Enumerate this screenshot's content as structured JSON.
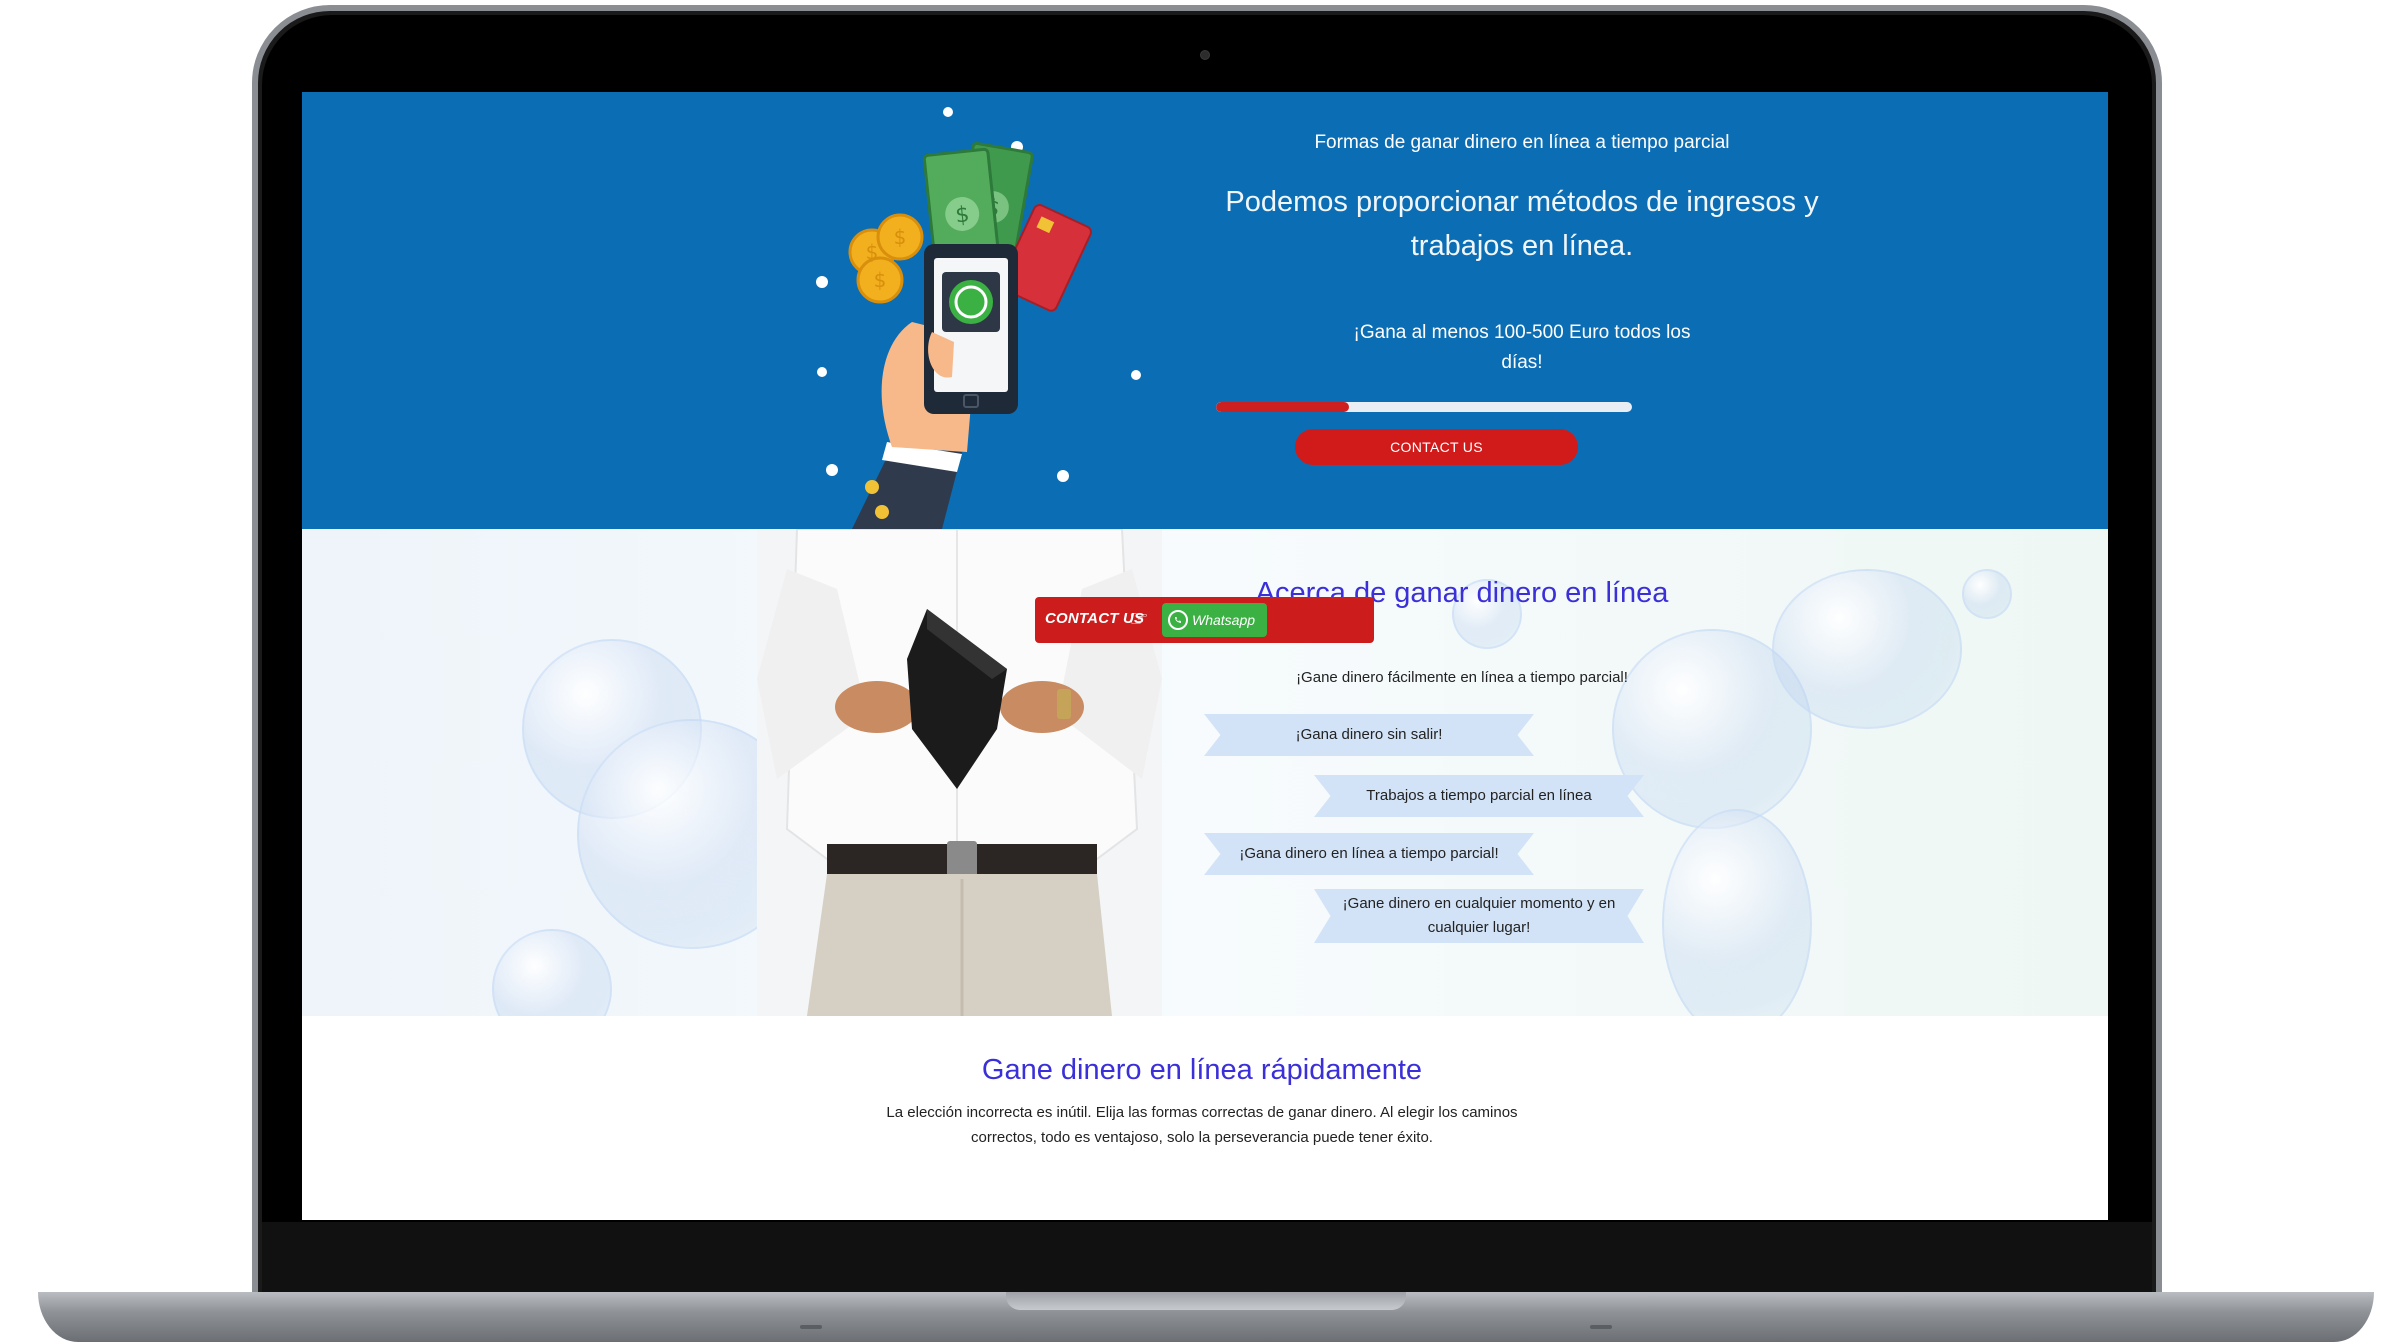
{
  "hero": {
    "subtitle": "Formas de ganar dinero en línea a tiempo parcial",
    "title": "Podemos proporcionar métodos de ingresos y trabajos en línea.",
    "earn_text": "¡Gana al menos 100-500 Euro todos los días!",
    "progress_fraction": 0.32,
    "button_label": "CONTACT US"
  },
  "floating_bar": {
    "contact_label": "CONTACT US",
    "whatsapp_label": "Whatsapp"
  },
  "about": {
    "title": "Acerca de ganar dinero en línea",
    "lead": "¡Gane dinero fácilmente en línea a tiempo parcial!",
    "items": [
      "¡Gana dinero sin salir!",
      "Trabajos a tiempo parcial en línea",
      "¡Gana dinero en línea a tiempo parcial!",
      "¡Gane dinero en cualquier momento y en cualquier lugar!"
    ]
  },
  "bottom": {
    "title": "Gane dinero en línea rápidamente",
    "text": "La elección incorrecta es inútil. Elija las formas correctas de ganar dinero. Al elegir los caminos correctos, todo es ventajoso, solo la perseverancia puede tener éxito."
  },
  "colors": {
    "hero_bg": "#0b6db3",
    "accent_red": "#d11a1a",
    "heading_blue": "#3a2fd8",
    "whatsapp_green": "#3bb143"
  }
}
